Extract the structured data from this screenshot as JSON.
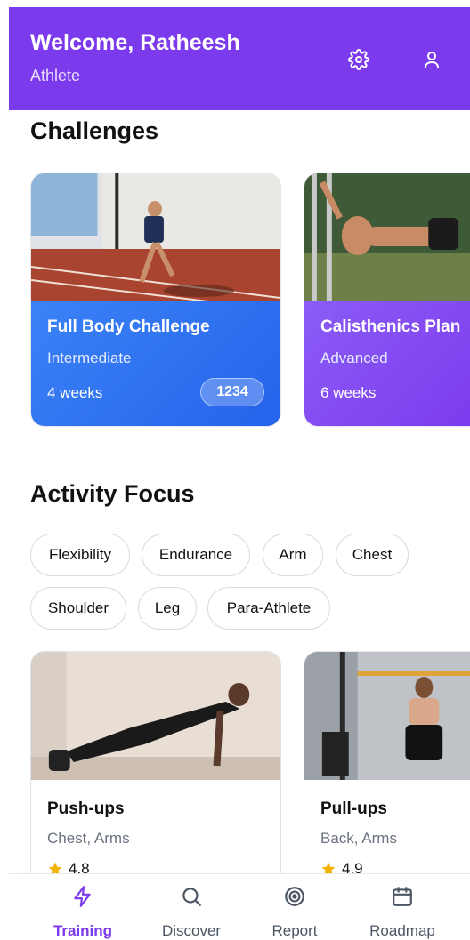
{
  "header": {
    "title": "Welcome, Ratheesh",
    "subtitle": "Athlete",
    "settings_icon": "gear-icon",
    "profile_icon": "user-icon",
    "background": "#7c3aed"
  },
  "challenges": {
    "title": "Challenges",
    "cards": [
      {
        "name": "Full Body Challenge",
        "level": "Intermediate",
        "duration": "4 weeks",
        "count": "1234",
        "color": "#2f6ef0"
      },
      {
        "name": "Calisthenics Plan",
        "level": "Advanced",
        "duration": "6 weeks",
        "color": "#8b5cf6"
      }
    ]
  },
  "activity": {
    "title": "Activity Focus",
    "chips": [
      "Flexibility",
      "Endurance",
      "Arm",
      "Chest",
      "Shoulder",
      "Leg",
      "Para-Athlete"
    ]
  },
  "exercises": [
    {
      "name": "Push-ups",
      "muscles": "Chest, Arms",
      "rating": "4.8"
    },
    {
      "name": "Pull-ups",
      "muscles": "Back, Arms",
      "rating": "4.9"
    }
  ],
  "nav": {
    "items": [
      {
        "label": "Training",
        "icon": "bolt-icon",
        "active": true
      },
      {
        "label": "Discover",
        "icon": "search-icon",
        "active": false
      },
      {
        "label": "Report",
        "icon": "target-icon",
        "active": false
      },
      {
        "label": "Roadmap",
        "icon": "calendar-icon",
        "active": false
      }
    ],
    "accent": "#7c3aed"
  }
}
